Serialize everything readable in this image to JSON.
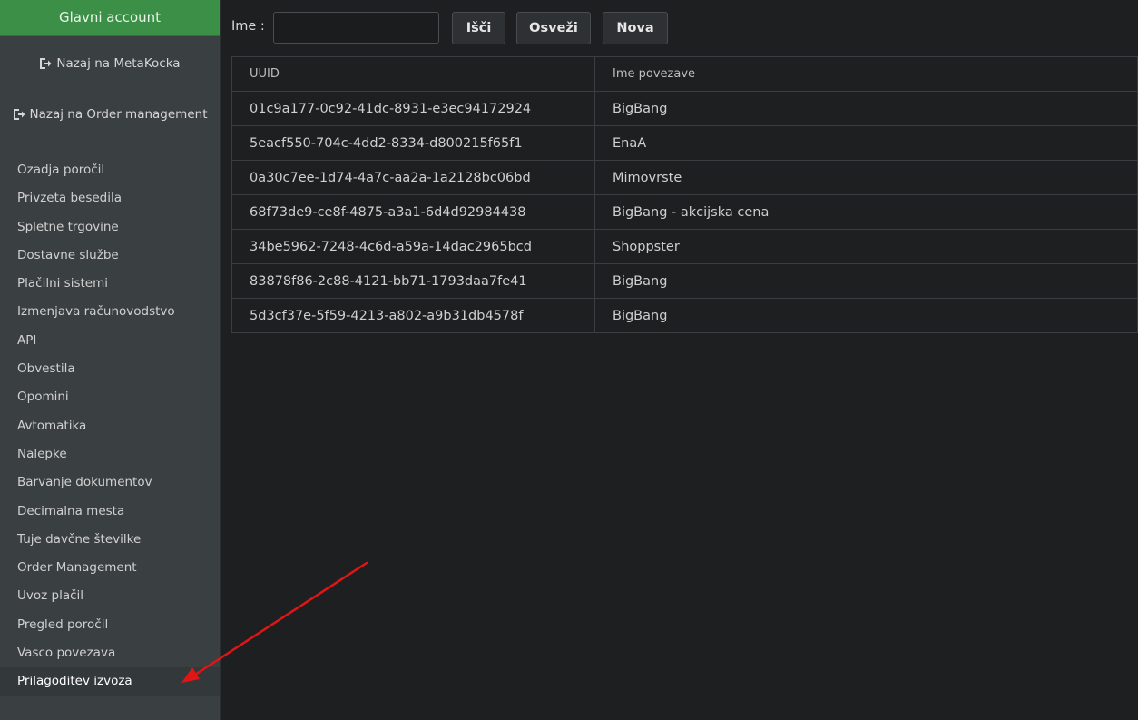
{
  "sidebar": {
    "account_label": "Glavni account",
    "back_metakocka": "Nazaj na MetaKocka",
    "back_order": "Nazaj na Order management",
    "items": [
      "Ozadja poročil",
      "Privzeta besedila",
      "Spletne trgovine",
      "Dostavne službe",
      "Plačilni sistemi",
      "Izmenjava računovodstvo",
      "API",
      "Obvestila",
      "Opomini",
      "Avtomatika",
      "Nalepke",
      "Barvanje dokumentov",
      "Decimalna mesta",
      "Tuje davčne številke",
      "Order Management",
      "Uvoz plačil",
      "Pregled poročil",
      "Vasco povezava",
      "Prilagoditev izvoza"
    ],
    "active_item": "Prilagoditev izvoza"
  },
  "toolbar": {
    "name_label": "Ime :",
    "name_value": "",
    "search_label": "Išči",
    "refresh_label": "Osveži",
    "new_label": "Nova"
  },
  "table": {
    "columns": [
      "UUID",
      "Ime povezave"
    ],
    "rows": [
      [
        "01c9a177-0c92-41dc-8931-e3ec94172924",
        "BigBang"
      ],
      [
        "5eacf550-704c-4dd2-8334-d800215f65f1",
        "EnaA"
      ],
      [
        "0a30c7ee-1d74-4a7c-aa2a-1a2128bc06bd",
        "Mimovrste"
      ],
      [
        "68f73de9-ce8f-4875-a3a1-6d4d92984438",
        "BigBang - akcijska cena"
      ],
      [
        "34be5962-7248-4c6d-a59a-14dac2965bcd",
        "Shoppster"
      ],
      [
        "83878f86-2c88-4121-bb71-1793daa7fe41",
        "BigBang"
      ],
      [
        "5d3cf37e-5f59-4213-a802-a9b31db4578f",
        "BigBang"
      ]
    ]
  },
  "colors": {
    "accent_green": "#3b8f46",
    "annotation_arrow": "#e01515"
  },
  "icons": {
    "back": "sign-out-icon"
  }
}
